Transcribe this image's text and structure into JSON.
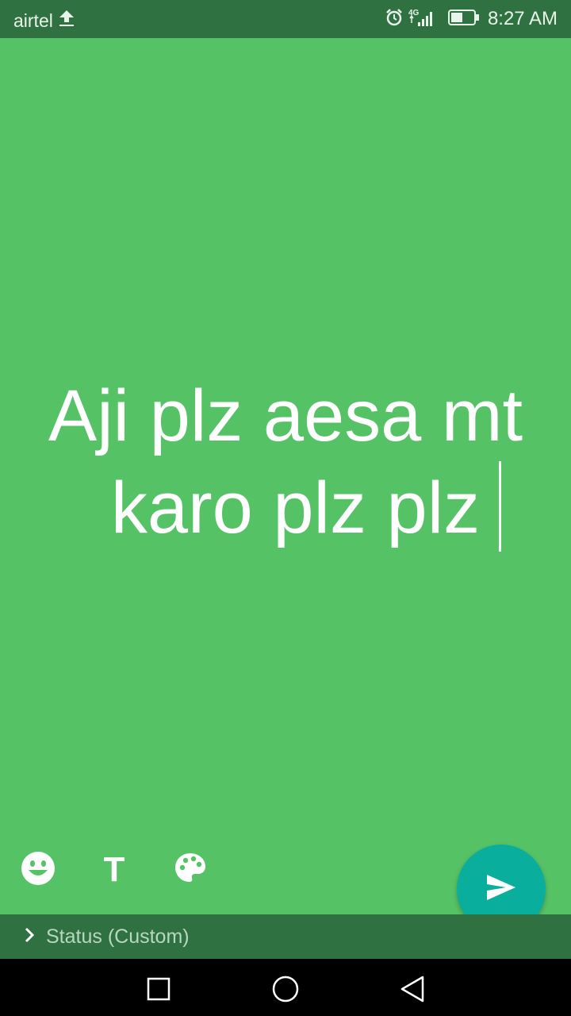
{
  "status_bar": {
    "carrier": "airtel",
    "network": "4G",
    "time": "8:27 AM",
    "battery_level_pct": 45,
    "icons": [
      "upload-icon",
      "alarm-icon",
      "signal-icon",
      "battery-icon"
    ]
  },
  "status_text": {
    "line1": "Aji plz aesa mt",
    "line2": "karo plz plz"
  },
  "toolbar": {
    "emoji_icon": "emoji-icon",
    "font_label": "T",
    "palette_icon": "palette-icon"
  },
  "fab": {
    "icon": "send-icon",
    "color": "#0aae9c"
  },
  "footer": {
    "label": "Status (Custom)"
  },
  "nav_bar": {
    "items": [
      "recents-square",
      "home-circle",
      "back-triangle"
    ]
  },
  "colors": {
    "background": "#56c266",
    "dark_green": "#2f7140",
    "accent": "#0aae9c"
  }
}
